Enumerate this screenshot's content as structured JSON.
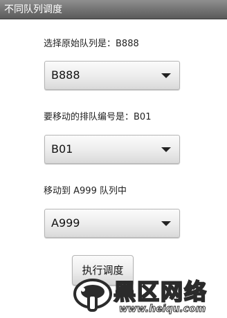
{
  "window": {
    "title": "不同队列调度"
  },
  "form": {
    "source_queue_label": "选择原始队列是：B888",
    "source_queue_value": "B888",
    "item_number_label": "要移动的排队编号是：B01",
    "item_number_value": "B01",
    "target_queue_label": "移动到 A999 队列中",
    "target_queue_value": "A999",
    "execute_button": "执行调度"
  },
  "watermark": {
    "title": "黑区网络",
    "url": "www.heiqu.com"
  },
  "icons": {
    "spinner_arrow": "triangle-down-icon"
  },
  "colors": {
    "title_bar": "#6e6e6e",
    "background": "#ffffff",
    "text": "#222222"
  }
}
